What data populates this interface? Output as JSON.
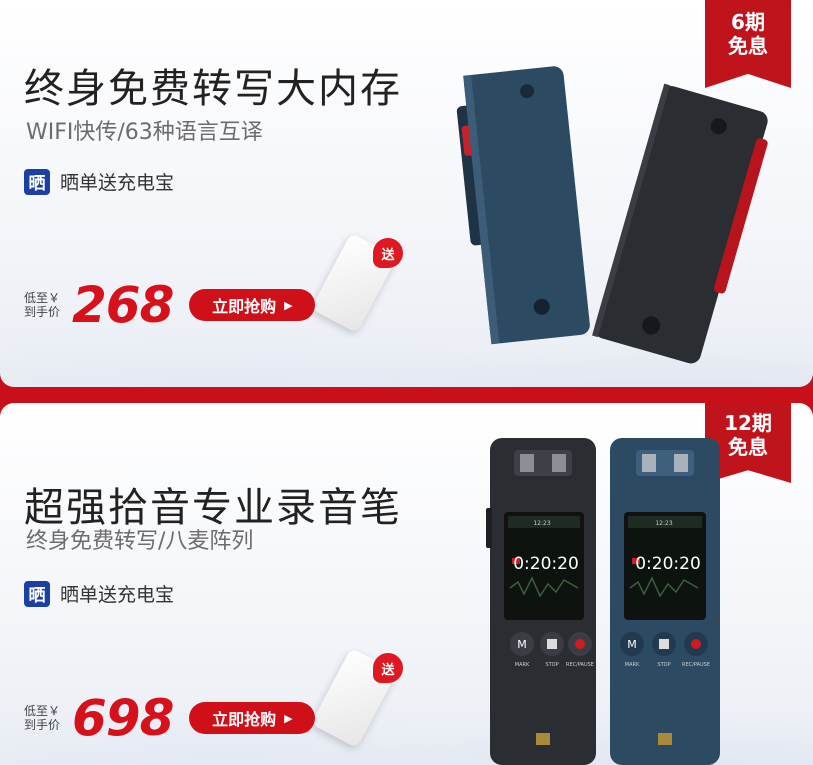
{
  "card1": {
    "badge_line1": "6期",
    "badge_line2": "免息",
    "title": "终身免费转写大内存",
    "subtitle": "WIFI快传/63种语言互译",
    "gift_icon_char": "晒",
    "gift_text": "晒单送充电宝",
    "gift_tag": "送",
    "price_label_line1": "低至￥",
    "price_label_line2": "到手价",
    "price": "268",
    "buy_label": "立即抢购"
  },
  "card2": {
    "badge_line1": "12期",
    "badge_line2": "免息",
    "title": "超强拾音专业录音笔",
    "subtitle": "终身免费转写/八麦阵列",
    "gift_icon_char": "晒",
    "gift_text": "晒单送充电宝",
    "gift_tag": "送",
    "price_label_line1": "低至￥",
    "price_label_line2": "到手价",
    "price": "698",
    "buy_label": "立即抢购",
    "screen_time": "0:20:20",
    "screen_clock": "12:23",
    "key_mark": "MARK",
    "key_stop": "STOP",
    "key_rec": "REC/PAUSE",
    "key_m": "M"
  },
  "colors": {
    "brand_red": "#cf1019",
    "gift_blue": "#1c3fa3",
    "device_navy": "#2d4a63",
    "device_black": "#2a2d31"
  }
}
